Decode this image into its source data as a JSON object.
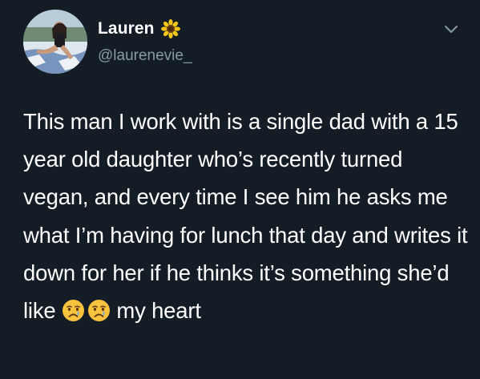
{
  "user": {
    "display_name": "Lauren",
    "handle": "@laurenevie_",
    "name_emoji": "sunflower-icon"
  },
  "tweet": {
    "text_before_emoji": "This man I work with is a single dad with a 15 year old daughter who’s recently turned vegan, and every time I see him he asks me what I’m having for lunch that day and writes it down for her if he thinks it’s something she’d like",
    "emojis": [
      "crying-face-icon",
      "crying-face-icon"
    ],
    "text_after_emoji": "my heart"
  },
  "colors": {
    "background": "#141d26",
    "text": "#ffffff",
    "secondary_text": "#8899a6"
  }
}
